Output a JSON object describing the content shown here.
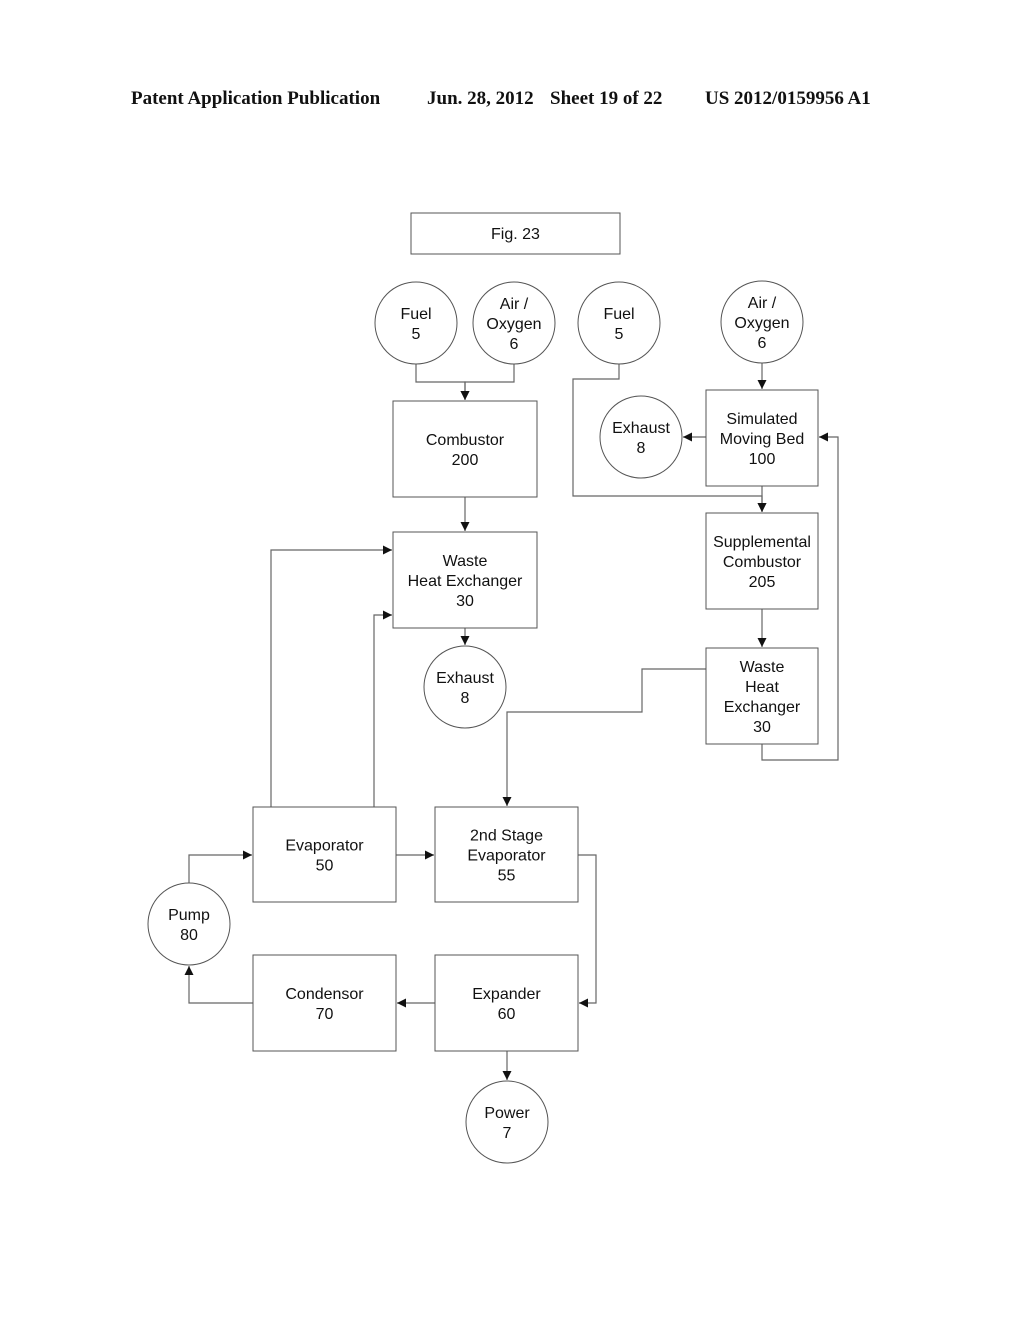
{
  "header": {
    "publication": "Patent Application Publication",
    "date": "Jun. 28, 2012",
    "sheet": "Sheet 19 of 22",
    "number": "US 2012/0159956 A1"
  },
  "figure": {
    "title": "Fig. 23",
    "nodes": [
      {
        "id": "fuel-a",
        "shape": "circle",
        "lines": [
          "Fuel",
          "5"
        ]
      },
      {
        "id": "air-a",
        "shape": "circle",
        "lines": [
          "Air /",
          "Oxygen",
          "6"
        ]
      },
      {
        "id": "fuel-b",
        "shape": "circle",
        "lines": [
          "Fuel",
          "5"
        ]
      },
      {
        "id": "air-b",
        "shape": "circle",
        "lines": [
          "Air /",
          "Oxygen",
          "6"
        ]
      },
      {
        "id": "combustor",
        "shape": "box",
        "lines": [
          "Combustor",
          "200"
        ]
      },
      {
        "id": "exhaust-b",
        "shape": "circle",
        "lines": [
          "Exhaust",
          "8"
        ]
      },
      {
        "id": "smb",
        "shape": "box",
        "lines": [
          "Simulated",
          "Moving Bed",
          "100"
        ]
      },
      {
        "id": "whx-a",
        "shape": "box",
        "lines": [
          "Waste",
          "Heat Exchanger",
          "30"
        ]
      },
      {
        "id": "supp-comb",
        "shape": "box",
        "lines": [
          "Supplemental",
          "Combustor",
          "205"
        ]
      },
      {
        "id": "exhaust-a",
        "shape": "circle",
        "lines": [
          "Exhaust",
          "8"
        ]
      },
      {
        "id": "whx-b",
        "shape": "box",
        "lines": [
          "Waste",
          "Heat",
          "Exchanger",
          "30"
        ]
      },
      {
        "id": "evaporator",
        "shape": "box",
        "lines": [
          "Evaporator",
          "50"
        ]
      },
      {
        "id": "evap2",
        "shape": "box",
        "lines": [
          "2nd Stage",
          "Evaporator",
          "55"
        ]
      },
      {
        "id": "pump",
        "shape": "circle",
        "lines": [
          "Pump",
          "80"
        ]
      },
      {
        "id": "condensor",
        "shape": "box",
        "lines": [
          "Condensor",
          "70"
        ]
      },
      {
        "id": "expander",
        "shape": "box",
        "lines": [
          "Expander",
          "60"
        ]
      },
      {
        "id": "power",
        "shape": "circle",
        "lines": [
          "Power",
          "7"
        ]
      }
    ],
    "edges": [
      {
        "from": "fuel-a",
        "to": "combustor"
      },
      {
        "from": "air-a",
        "to": "combustor"
      },
      {
        "from": "combustor",
        "to": "whx-a"
      },
      {
        "from": "whx-a",
        "to": "exhaust-a"
      },
      {
        "from": "air-b",
        "to": "smb"
      },
      {
        "from": "smb",
        "to": "exhaust-b"
      },
      {
        "from": "fuel-b",
        "to": "supp-comb"
      },
      {
        "from": "smb",
        "to": "supp-comb"
      },
      {
        "from": "supp-comb",
        "to": "whx-b"
      },
      {
        "from": "whx-b",
        "to": "smb"
      },
      {
        "from": "whx-b",
        "to": "evap2"
      },
      {
        "from": "evaporator",
        "to": "whx-a"
      },
      {
        "from": "whx-a",
        "to": "evaporator"
      },
      {
        "from": "pump",
        "to": "evaporator"
      },
      {
        "from": "evaporator",
        "to": "evap2"
      },
      {
        "from": "evap2",
        "to": "expander"
      },
      {
        "from": "expander",
        "to": "condensor"
      },
      {
        "from": "condensor",
        "to": "pump"
      },
      {
        "from": "expander",
        "to": "power"
      }
    ]
  }
}
